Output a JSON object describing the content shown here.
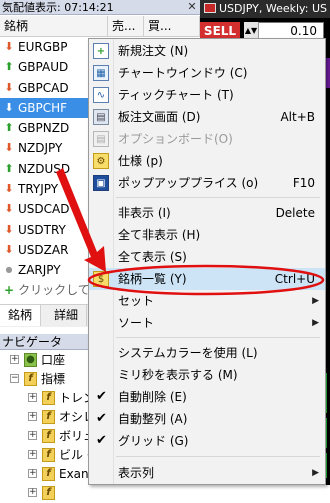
{
  "market_watch": {
    "title": "気配値表示: 07:14:21",
    "close_glyph": "✕",
    "headers": {
      "symbol": "銘柄",
      "bid": "売...",
      "ask": "買..."
    },
    "rows": [
      {
        "symbol": "EURGBP",
        "dir": "down"
      },
      {
        "symbol": "GBPAUD",
        "dir": "up"
      },
      {
        "symbol": "GBPCAD",
        "dir": "down"
      },
      {
        "symbol": "GBPCHF",
        "dir": "down",
        "selected": true
      },
      {
        "symbol": "GBPNZD",
        "dir": "up"
      },
      {
        "symbol": "NZDJPY",
        "dir": "down"
      },
      {
        "symbol": "NZDUSD",
        "dir": "up"
      },
      {
        "symbol": "TRYJPY",
        "dir": "down"
      },
      {
        "symbol": "USDCAD",
        "dir": "down"
      },
      {
        "symbol": "USDTRY",
        "dir": "down"
      },
      {
        "symbol": "USDZAR",
        "dir": "down"
      },
      {
        "symbol": "ZARJPY",
        "dir": "neutral"
      }
    ],
    "add_row": "クリックして追加",
    "tabs": [
      "銘柄",
      "詳細"
    ]
  },
  "navigator": {
    "title": "ナビゲータ",
    "nodes": [
      {
        "label": "口座",
        "level": 1,
        "icon": "accounts-icon",
        "expander": "+"
      },
      {
        "label": "指標",
        "level": 1,
        "icon": "indicators-icon",
        "expander": "−"
      },
      {
        "label": "トレン",
        "level": 2,
        "expander": "+"
      },
      {
        "label": "オシレ",
        "level": 2,
        "expander": "+"
      },
      {
        "label": "ボリュ",
        "level": 2,
        "expander": "+"
      },
      {
        "label": "ビル・",
        "level": 2,
        "expander": "+"
      },
      {
        "label": "Exan",
        "level": 2,
        "expander": "+"
      },
      {
        "label": "",
        "level": 2,
        "expander": "+"
      }
    ]
  },
  "chart": {
    "tab_title": "USDJPY, Weekly: US",
    "sell_label": "SELL",
    "lot_value": "0.10",
    "spin_glyph": "▲▼"
  },
  "context_menu": {
    "items": [
      {
        "label": "新規注文 (N)",
        "icon": "new-order-icon",
        "glyph": "+"
      },
      {
        "label": "チャートウインドウ (C)",
        "icon": "chart-window-icon",
        "glyph": "▦"
      },
      {
        "label": "ティックチャート (T)",
        "icon": "tick-chart-icon",
        "glyph": "∿"
      },
      {
        "label": "板注文画面 (D)",
        "shortcut": "Alt+B",
        "icon": "order-board-icon",
        "glyph": "▤"
      },
      {
        "label": "オプションボード(O)",
        "disabled": true,
        "icon": "option-board-icon",
        "glyph": "▤"
      },
      {
        "label": "仕様 (p)",
        "icon": "specification-icon",
        "glyph": "⚙"
      },
      {
        "label": "ポップアッププライス (o)",
        "shortcut": "F10",
        "icon": "popup-prices-icon",
        "glyph": "▣"
      },
      {
        "label": "非表示 (I)",
        "shortcut": "Delete"
      },
      {
        "label": "全て非表示 (H)"
      },
      {
        "label": "全て表示 (S)"
      },
      {
        "label": "銘柄一覧 (Y)",
        "shortcut": "Ctrl+U",
        "icon": "symbols-icon",
        "glyph": "$",
        "highlight": true
      },
      {
        "label": "セット",
        "submenu": true
      },
      {
        "label": "ソート",
        "submenu": true
      },
      {
        "label": "システムカラーを使用 (L)"
      },
      {
        "label": "ミリ秒を表示する (M)"
      },
      {
        "label": "自動削除 (E)",
        "checked": true
      },
      {
        "label": "自動整列 (A)",
        "checked": true
      },
      {
        "label": "グリッド (G)",
        "checked": true
      },
      {
        "label": "表示列",
        "submenu": true
      }
    ],
    "check_glyph": "✔",
    "submenu_glyph": "▶"
  },
  "colors": {
    "selection": "#3a8ee6",
    "up_arrow": "#2ca02c",
    "down_arrow": "#e0572a",
    "annotation_red": "#e01010",
    "sell_button": "#d32f2f"
  }
}
